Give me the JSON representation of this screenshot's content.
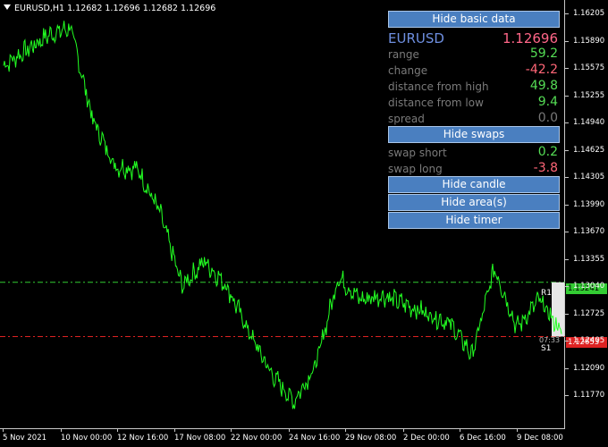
{
  "window": {
    "title": "EURUSD,H1  1.12682 1.12696 1.12682 1.12696"
  },
  "colors": {
    "background": "#000000",
    "price_line": "#22ff22",
    "resistance": "#33cc33",
    "support": "#dd2222",
    "button": "#4a7fc0",
    "positive": "#55dd55",
    "negative": "#ff6677",
    "neutral": "#777777",
    "symbol": "#6e8fe0",
    "current_price": "#ff6688"
  },
  "price_axis": {
    "labels": [
      "1.16205",
      "1.15890",
      "1.15575",
      "1.15255",
      "1.14940",
      "1.14625",
      "1.14305",
      "1.13990",
      "1.13670",
      "1.13355",
      "1.13040",
      "1.12725",
      "1.12405",
      "1.12090",
      "1.11770"
    ],
    "resistance_tag": "1.13241",
    "support_tag": "1.12653"
  },
  "time_axis": {
    "labels": [
      "5 Nov 2021",
      "10 Nov 00:00",
      "12 Nov 16:00",
      "17 Nov 08:00",
      "22 Nov 00:00",
      "24 Nov 16:00",
      "29 Nov 08:00",
      "2 Dec 00:00",
      "6 Dec 16:00",
      "9 Dec 08:00"
    ]
  },
  "markers": {
    "r1": "R1",
    "s1": "S1",
    "timer": "07:33"
  },
  "panel": {
    "hide_basic_data": "Hide basic data",
    "symbol": "EURUSD",
    "price": "1.12696",
    "rows": [
      {
        "label": "range",
        "value": "59.2",
        "tone": "positive"
      },
      {
        "label": "change",
        "value": "-42.2",
        "tone": "negative"
      },
      {
        "label": "distance from high",
        "value": "49.8",
        "tone": "positive"
      },
      {
        "label": "distance from low",
        "value": "9.4",
        "tone": "positive"
      },
      {
        "label": "spread",
        "value": "0.0",
        "tone": "neutral"
      }
    ],
    "hide_swaps": "Hide swaps",
    "swap_rows": [
      {
        "label": "swap short",
        "value": "0.2",
        "tone": "positive"
      },
      {
        "label": "swap long",
        "value": "-3.8",
        "tone": "negative"
      }
    ],
    "hide_candle": "Hide candle",
    "hide_areas": "Hide area(s)",
    "hide_timer": "Hide timer"
  },
  "chart_data": {
    "type": "line",
    "symbol": "EURUSD",
    "timeframe": "H1",
    "x": [
      "5 Nov 2021",
      "8 Nov",
      "9 Nov",
      "10 Nov 00:00",
      "11 Nov",
      "12 Nov 16:00",
      "15 Nov",
      "16 Nov",
      "17 Nov 08:00",
      "18 Nov",
      "19 Nov",
      "22 Nov 00:00",
      "23 Nov",
      "24 Nov 16:00",
      "25 Nov",
      "26 Nov",
      "29 Nov 08:00",
      "30 Nov",
      "1 Dec",
      "2 Dec 00:00",
      "3 Dec",
      "6 Dec 16:00",
      "7 Dec",
      "8 Dec",
      "9 Dec 08:00",
      "9 Dec 16:00"
    ],
    "values": [
      1.1559,
      1.1575,
      1.1592,
      1.16,
      1.15,
      1.145,
      1.1447,
      1.14,
      1.132,
      1.1347,
      1.132,
      1.127,
      1.1225,
      1.1195,
      1.1235,
      1.133,
      1.1305,
      1.131,
      1.13,
      1.129,
      1.128,
      1.1245,
      1.134,
      1.1275,
      1.1305,
      1.127
    ],
    "ylim": [
      1.1165,
      1.163
    ],
    "resistance": 1.13241,
    "support": 1.12653,
    "last_price": 1.12696,
    "grid": false
  }
}
